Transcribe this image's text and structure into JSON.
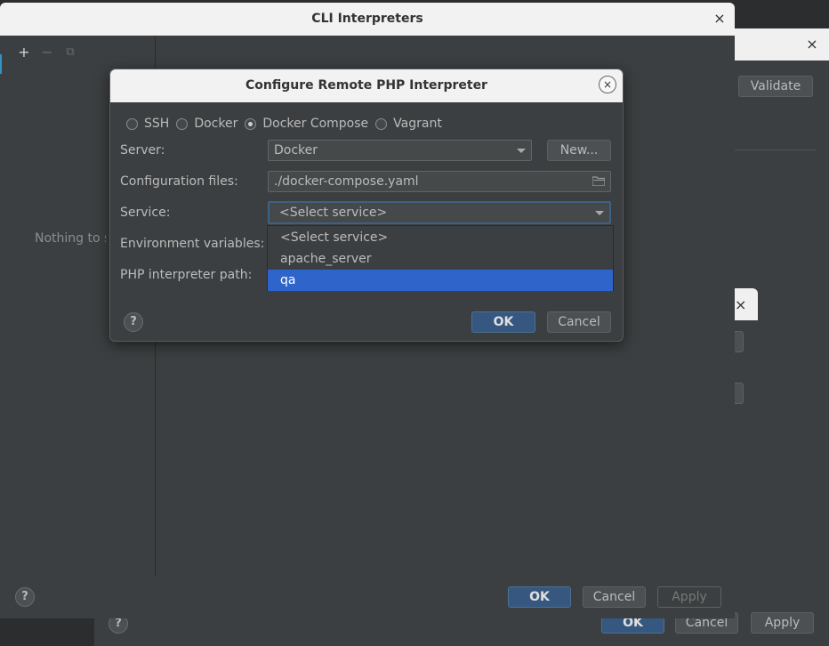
{
  "background_dialog": {
    "validate_label": "Validate",
    "close_glyph": "×",
    "ok_label": "OK",
    "cancel_label": "Cancel",
    "apply_label": "Apply",
    "help_glyph": "?"
  },
  "cli_window": {
    "title": "CLI Interpreters",
    "close_glyph": "×",
    "toolbar": {
      "add": "+",
      "remove": "−",
      "copy": "⧉"
    },
    "empty_text": "Nothing to show",
    "help_glyph": "?",
    "ok_label": "OK",
    "cancel_label": "Cancel",
    "apply_label": "Apply"
  },
  "modal": {
    "title": "Configure Remote PHP Interpreter",
    "close_glyph": "×",
    "radios": [
      {
        "label": "SSH",
        "checked": false
      },
      {
        "label": "Docker",
        "checked": false
      },
      {
        "label": "Docker Compose",
        "checked": true
      },
      {
        "label": "Vagrant",
        "checked": false
      }
    ],
    "server_label": "Server:",
    "server_value": "Docker",
    "new_button": "New...",
    "config_files_label": "Configuration files:",
    "config_files_value": "./docker-compose.yaml",
    "service_label": "Service:",
    "service_value": "<Select service>",
    "env_vars_label": "Environment variables:",
    "php_path_label": "PHP interpreter path:",
    "service_options": [
      {
        "label": "<Select service>",
        "selected": false
      },
      {
        "label": "apache_server",
        "selected": false
      },
      {
        "label": "qa",
        "selected": true
      }
    ],
    "help_glyph": "?",
    "ok_label": "OK",
    "cancel_label": "Cancel"
  },
  "colors": {
    "accent": "#2f65ca",
    "primary_button": "#365880",
    "panel": "#3c3f41",
    "title_bar": "#f2f2f2"
  }
}
